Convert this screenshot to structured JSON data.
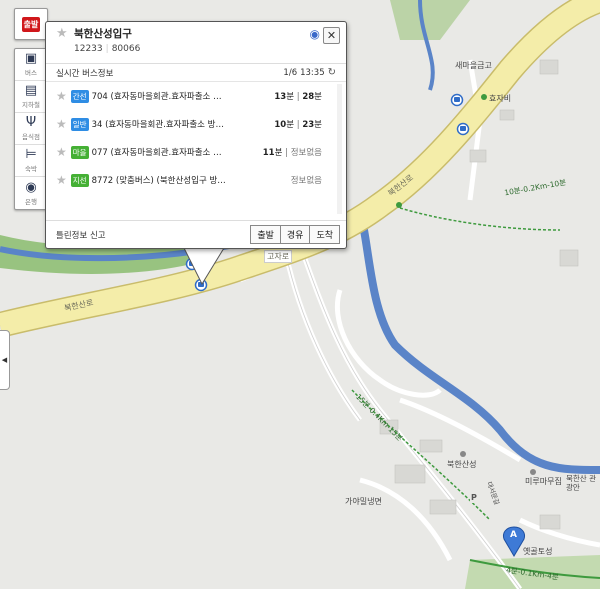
{
  "toolbar": {
    "start_label": "출발",
    "items": [
      {
        "label": "버스",
        "icon": "bus-icon"
      },
      {
        "label": "지하철",
        "icon": "subway-icon"
      },
      {
        "label": "음식점",
        "icon": "restaurant-icon"
      },
      {
        "label": "숙박",
        "icon": "bed-icon"
      },
      {
        "label": "은행",
        "icon": "bank-icon"
      }
    ]
  },
  "popup": {
    "stop_name": "북한산성입구",
    "stop_id": "12233",
    "ars_id": "80066",
    "realtime_label": "실시간 버스정보",
    "page": "1/6",
    "time": "13:35",
    "buses": [
      {
        "type": "간선",
        "type_color": "#2f8de4",
        "name": "704 (효자동마을회관.효자파출소 …",
        "t1": "13",
        "t1_unit": "분",
        "t2": "28",
        "t2_unit": "분"
      },
      {
        "type": "일반",
        "type_color": "#2f8de4",
        "name": "34 (효자동마을회관.효자파출소 방…",
        "t1": "10",
        "t1_unit": "분",
        "t2": "23",
        "t2_unit": "분"
      },
      {
        "type": "마을",
        "type_color": "#45b035",
        "name": "077 (효자동마을회관.효자파출소 …",
        "t1": "11",
        "t1_unit": "분",
        "t2_text": "정보없음"
      },
      {
        "type": "지선",
        "type_color": "#45b035",
        "name": "8772 (맞춤버스) (북한산성입구 방…",
        "t2_text": "정보없음"
      }
    ],
    "report_label": "틀린정보 신고",
    "buttons": [
      "출발",
      "경유",
      "도착"
    ]
  },
  "map_labels": {
    "road_bukhansan_1": "북한산로",
    "road_bukhansan_2": "북한산로",
    "gojaro": "고자로",
    "saemaeul": "새마을금고",
    "hyojabi": "효자비",
    "route_east": "10분-0.2Km-10분",
    "route_south": "15분-0.4Km-15분",
    "route_bottom": "4분-0.1Km-4분",
    "bukhansanseong": "북한산성",
    "miru": "미루마무집",
    "gwanri": "북한산 관광안",
    "gaya": "가야밀냉면",
    "yetgol": "옛골토성",
    "marker_a": "A",
    "parking": "P",
    "road_small": "대서문길"
  },
  "colors": {
    "road": "#f4eda9",
    "road_edge": "#c9bc6b",
    "river": "#5a84c8",
    "green": "#8fbf74",
    "ground": "#e9e9e6"
  }
}
